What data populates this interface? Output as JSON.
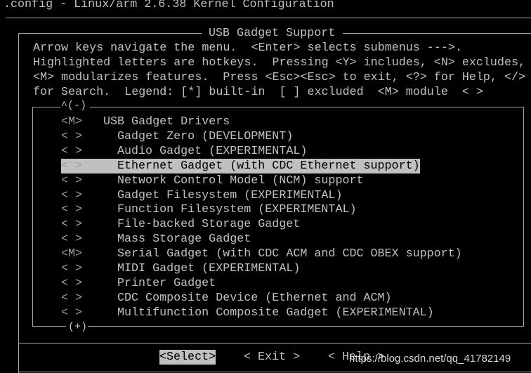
{
  "window_title": ".config - Linux/arm 2.6.38 Kernel Configuration",
  "dialog": {
    "title": "USB Gadget Support",
    "help_lines": [
      "Arrow keys navigate the menu.  <Enter> selects submenus --->.",
      "Highlighted letters are hotkeys.  Pressing <Y> includes, <N> excludes,",
      "<M> modularizes features.  Press <Esc><Esc> to exit, <?> for Help, </>",
      "for Search.  Legend: [*] built-in  [ ] excluded  <M> module  < >"
    ],
    "scroll_up_indicator": "^(-)",
    "scroll_down_indicator": "(+)",
    "selected_index": 3,
    "items": [
      {
        "state": "<M>",
        "label": "USB Gadget Drivers",
        "indent": 0
      },
      {
        "state": "< >",
        "label": "Gadget Zero (DEVELOPMENT)",
        "indent": 1
      },
      {
        "state": "< >",
        "label": "Audio Gadget (EXPERIMENTAL)",
        "indent": 1
      },
      {
        "state": "< >",
        "label": "Ethernet Gadget (with CDC Ethernet support)",
        "indent": 1
      },
      {
        "state": "< >",
        "label": "Network Control Model (NCM) support",
        "indent": 1
      },
      {
        "state": "< >",
        "label": "Gadget Filesystem (EXPERIMENTAL)",
        "indent": 1
      },
      {
        "state": "< >",
        "label": "Function Filesystem (EXPERIMENTAL)",
        "indent": 1
      },
      {
        "state": "< >",
        "label": "File-backed Storage Gadget",
        "indent": 1
      },
      {
        "state": "< >",
        "label": "Mass Storage Gadget",
        "indent": 1
      },
      {
        "state": "<M>",
        "label": "Serial Gadget (with CDC ACM and CDC OBEX support)",
        "indent": 1
      },
      {
        "state": "< >",
        "label": "MIDI Gadget (EXPERIMENTAL)",
        "indent": 1
      },
      {
        "state": "< >",
        "label": "Printer Gadget",
        "indent": 1
      },
      {
        "state": "< >",
        "label": "CDC Composite Device (Ethernet and ACM)",
        "indent": 1
      },
      {
        "state": "< >",
        "label": "Multifunction Composite Gadget (EXPERIMENTAL)",
        "indent": 1
      }
    ],
    "buttons": {
      "select": "<Select>",
      "exit": "< Exit >",
      "help": "< Help >"
    }
  },
  "watermark": "https://blog.csdn.net/qq_41782149"
}
